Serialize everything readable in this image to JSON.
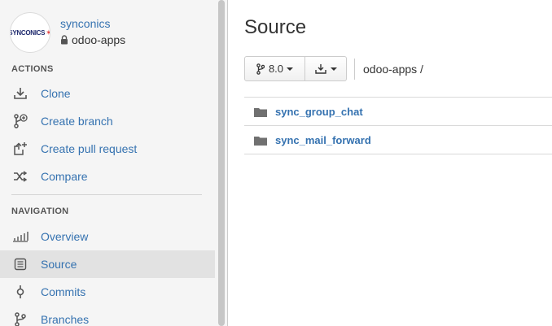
{
  "repo": {
    "owner": "synconics",
    "name": "odoo-apps",
    "avatar_text": "SYNCONICS"
  },
  "sidebar": {
    "actions_title": "ACTIONS",
    "actions": [
      {
        "label": "Clone",
        "icon": "clone-icon"
      },
      {
        "label": "Create branch",
        "icon": "create-branch-icon"
      },
      {
        "label": "Create pull request",
        "icon": "pull-request-icon"
      },
      {
        "label": "Compare",
        "icon": "compare-icon"
      }
    ],
    "navigation_title": "NAVIGATION",
    "navigation": [
      {
        "label": "Overview",
        "icon": "overview-icon"
      },
      {
        "label": "Source",
        "icon": "source-icon",
        "active": true
      },
      {
        "label": "Commits",
        "icon": "commits-icon"
      },
      {
        "label": "Branches",
        "icon": "branches-icon"
      }
    ]
  },
  "main": {
    "title": "Source",
    "branch": "8.0",
    "path": "odoo-apps /",
    "files": [
      {
        "name": "sync_group_chat",
        "type": "folder"
      },
      {
        "name": "sync_mail_forward",
        "type": "folder"
      }
    ]
  },
  "colors": {
    "link": "#3572b0",
    "sidebar_bg": "#f5f5f5",
    "active_bg": "#e2e2e2",
    "icon": "#555555"
  }
}
